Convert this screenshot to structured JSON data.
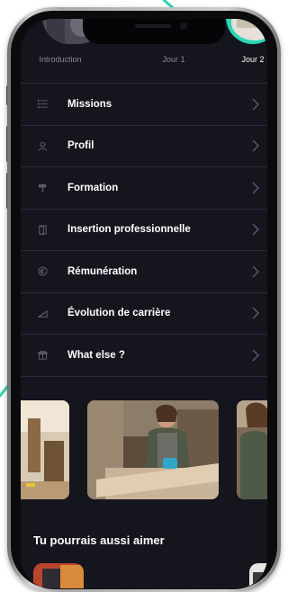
{
  "stories": [
    {
      "label": "Introduction",
      "active": false
    },
    {
      "label": "Jour 1",
      "active": false
    },
    {
      "label": "Jour 2",
      "active": true
    }
  ],
  "menu": [
    {
      "label": "Missions",
      "icon": "list-icon"
    },
    {
      "label": "Profil",
      "icon": "user-icon"
    },
    {
      "label": "Formation",
      "icon": "signpost-icon"
    },
    {
      "label": "Insertion professionnelle",
      "icon": "door-icon"
    },
    {
      "label": "Rémunération",
      "icon": "euro-icon"
    },
    {
      "label": "Évolution de carrière",
      "icon": "growth-icon"
    },
    {
      "label": "What else ?",
      "icon": "gift-icon"
    }
  ],
  "gallery": {
    "images": [
      "woodworker-photo",
      "woman-sanding-wood-photo",
      "woman-workshop-photo"
    ]
  },
  "recommendations": {
    "title": "Tu pourrais aussi aimer"
  },
  "colors": {
    "background": "#15151d",
    "divider": "#2c2c36",
    "accent": "#2ad6b5",
    "text": "#ffffff",
    "muted": "#8a8a93"
  }
}
